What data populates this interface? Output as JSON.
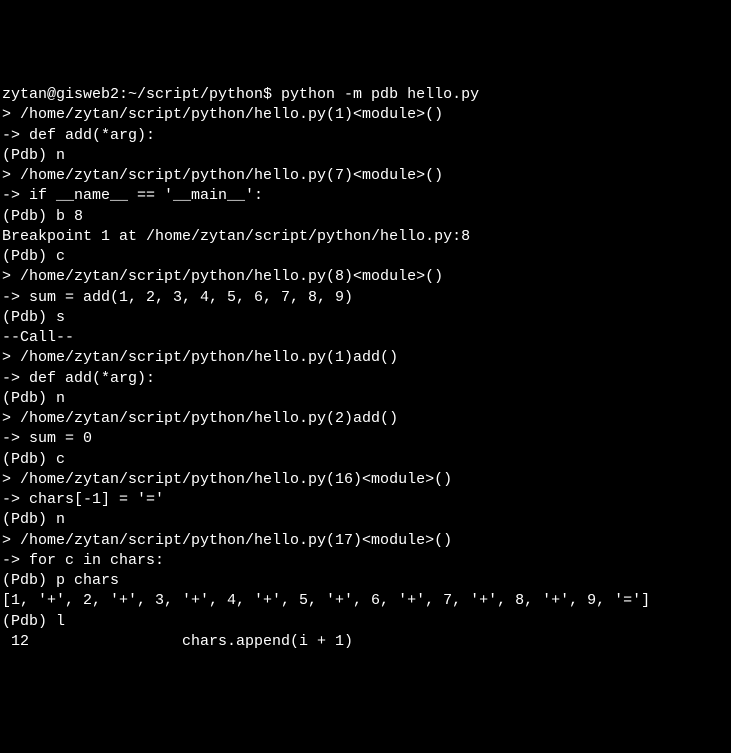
{
  "terminal": {
    "lines": [
      "zytan@gisweb2:~/script/python$ python -m pdb hello.py",
      "> /home/zytan/script/python/hello.py(1)<module>()",
      "-> def add(*arg):",
      "(Pdb) n",
      "> /home/zytan/script/python/hello.py(7)<module>()",
      "-> if __name__ == '__main__':",
      "(Pdb) b 8",
      "Breakpoint 1 at /home/zytan/script/python/hello.py:8",
      "(Pdb) c",
      "> /home/zytan/script/python/hello.py(8)<module>()",
      "-> sum = add(1, 2, 3, 4, 5, 6, 7, 8, 9)",
      "(Pdb) s",
      "--Call--",
      "> /home/zytan/script/python/hello.py(1)add()",
      "-> def add(*arg):",
      "(Pdb) n",
      "> /home/zytan/script/python/hello.py(2)add()",
      "-> sum = 0",
      "(Pdb) c",
      "> /home/zytan/script/python/hello.py(16)<module>()",
      "-> chars[-1] = '='",
      "(Pdb) n",
      "> /home/zytan/script/python/hello.py(17)<module>()",
      "-> for c in chars:",
      "(Pdb) p chars",
      "[1, '+', 2, '+', 3, '+', 4, '+', 5, '+', 6, '+', 7, '+', 8, '+', 9, '=']",
      "(Pdb) l",
      " 12                 chars.append(i + 1)"
    ]
  }
}
